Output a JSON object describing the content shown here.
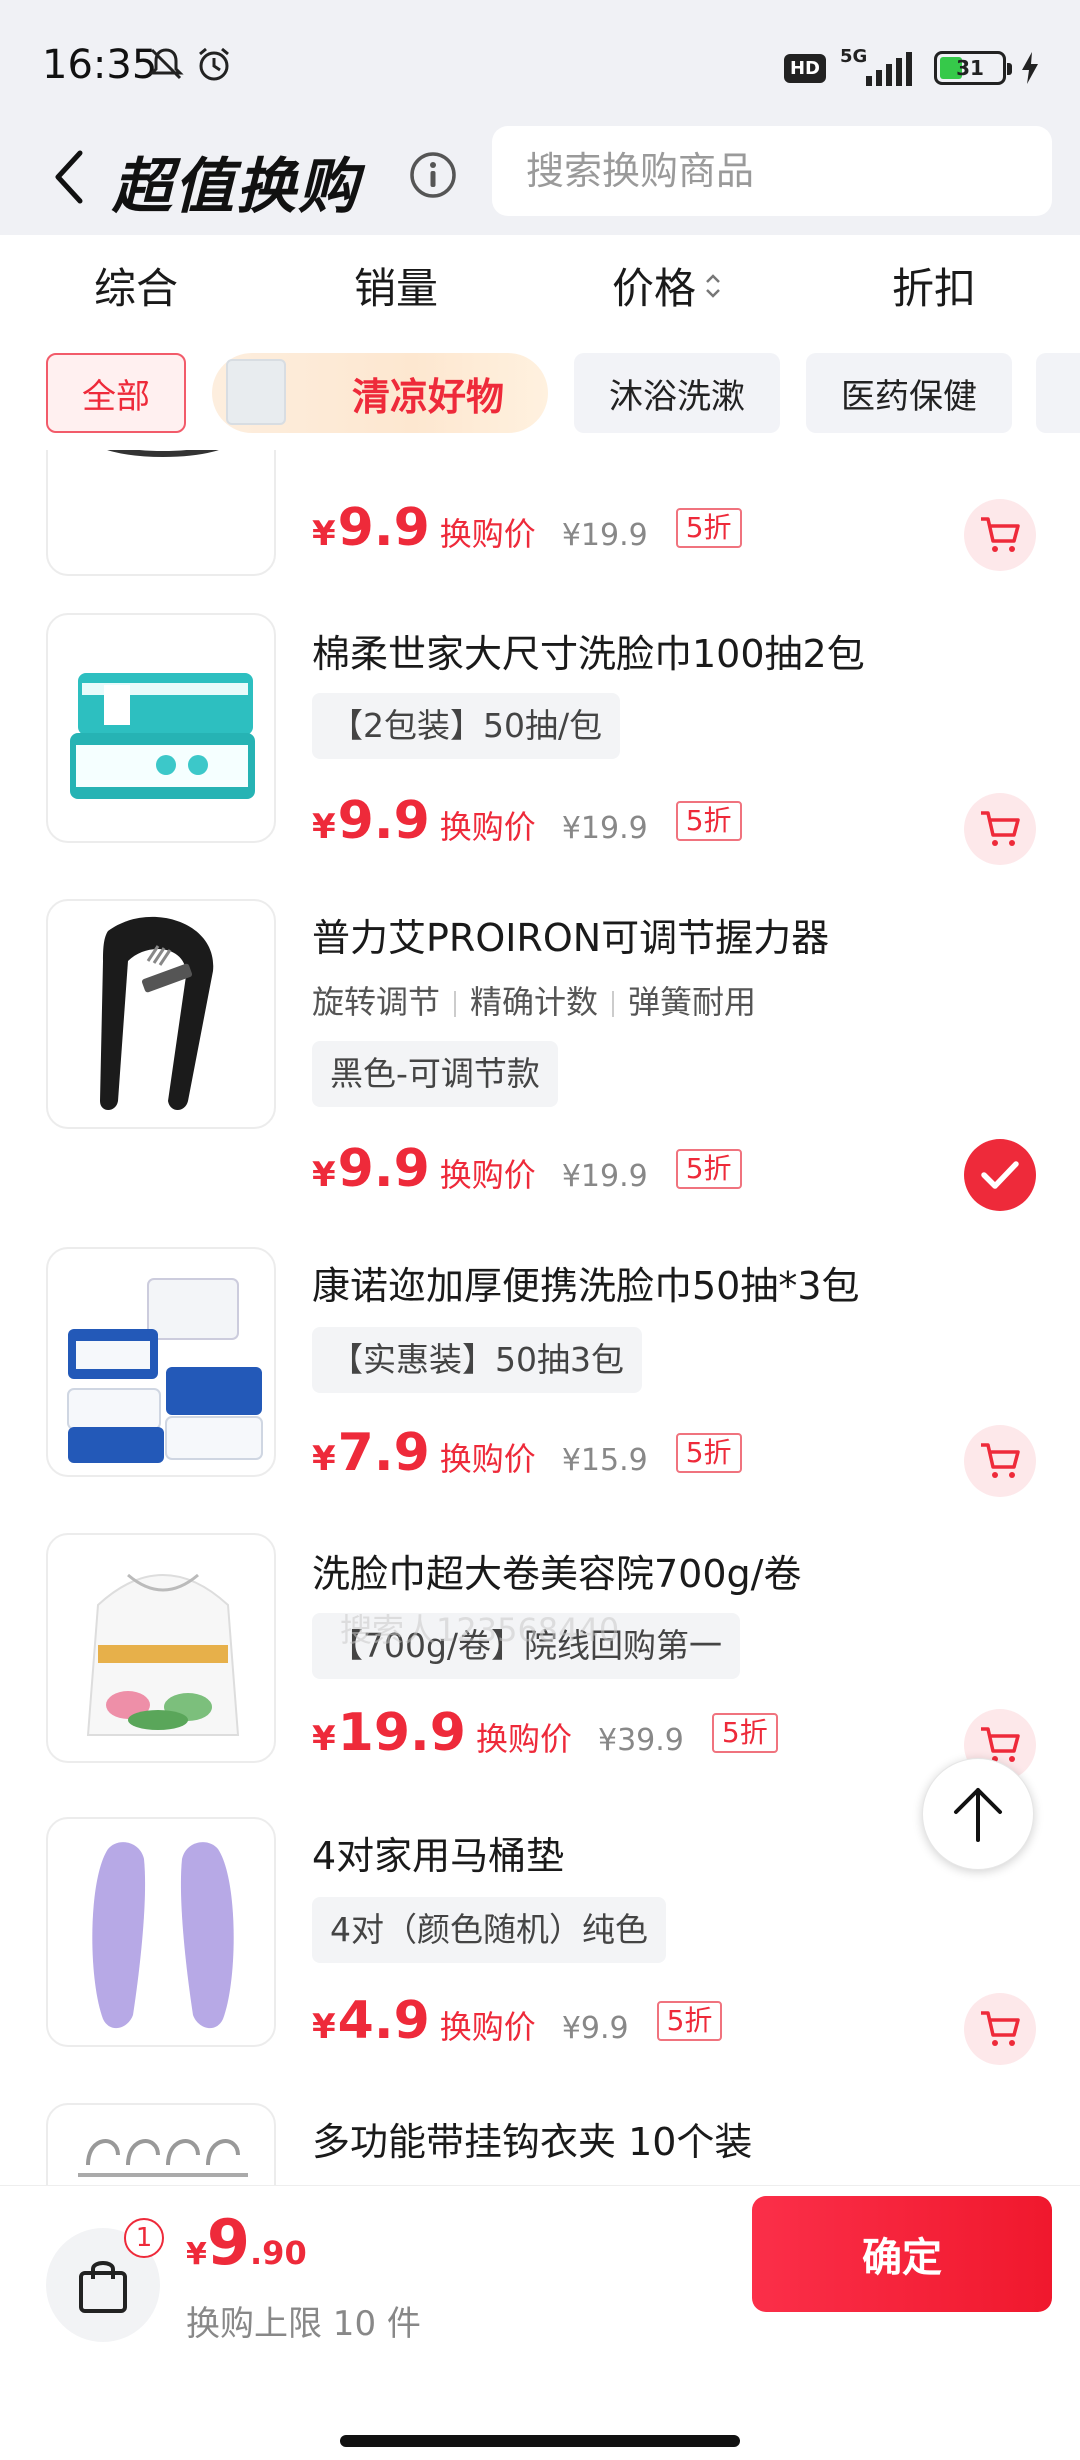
{
  "status_bar": {
    "time": "16:35",
    "hd": "HD",
    "network": "5G",
    "battery": "31"
  },
  "header": {
    "title": "超值换购",
    "search_placeholder": "搜索换购商品"
  },
  "sort_tabs": [
    "综合",
    "销量",
    "价格",
    "折扣"
  ],
  "categories": {
    "all": "全部",
    "promo": "清凉好物",
    "c1": "沐浴洗漱",
    "c2": "医药保健"
  },
  "price_label": "换购价",
  "currency": "¥",
  "products": [
    {
      "name": "",
      "price": "9.9",
      "original": "¥19.9",
      "discount": "5折",
      "selected": false
    },
    {
      "name": "棉柔世家大尺寸洗脸巾100抽2包",
      "tag": "【2包装】50抽/包",
      "price": "9.9",
      "original": "¥19.9",
      "discount": "5折",
      "selected": false
    },
    {
      "name": "普力艾PROIRON可调节握力器",
      "features": [
        "旋转调节",
        "精确计数",
        "弹簧耐用"
      ],
      "tag": "黑色-可调节款",
      "price": "9.9",
      "original": "¥19.9",
      "discount": "5折",
      "selected": true
    },
    {
      "name": "康诺迩加厚便携洗脸巾50抽*3包",
      "tag": "【实惠装】50抽3包",
      "price": "7.9",
      "original": "¥15.9",
      "discount": "5折",
      "selected": false
    },
    {
      "name": "洗脸巾超大卷美容院700g/卷",
      "tag": "【700g/卷】院线回购第一",
      "price": "19.9",
      "original": "¥39.9",
      "discount": "5折",
      "selected": false
    },
    {
      "name": "4对家用马桶垫",
      "tag": "4对（颜色随机）纯色",
      "price": "4.9",
      "original": "¥9.9",
      "discount": "5折",
      "selected": false
    },
    {
      "name": "多功能带挂钩衣夹 10个装"
    }
  ],
  "watermark": "搜索人123568440",
  "bottom": {
    "badge": "1",
    "currency": "¥",
    "total_int": "9",
    "total_dec": ".90",
    "limit": "换购上限 10 件",
    "confirm": "确定"
  },
  "colors": {
    "accent": "#ee2a3a",
    "cart_bg": "#fde8ea",
    "header_bg": "#f0f1f5"
  }
}
